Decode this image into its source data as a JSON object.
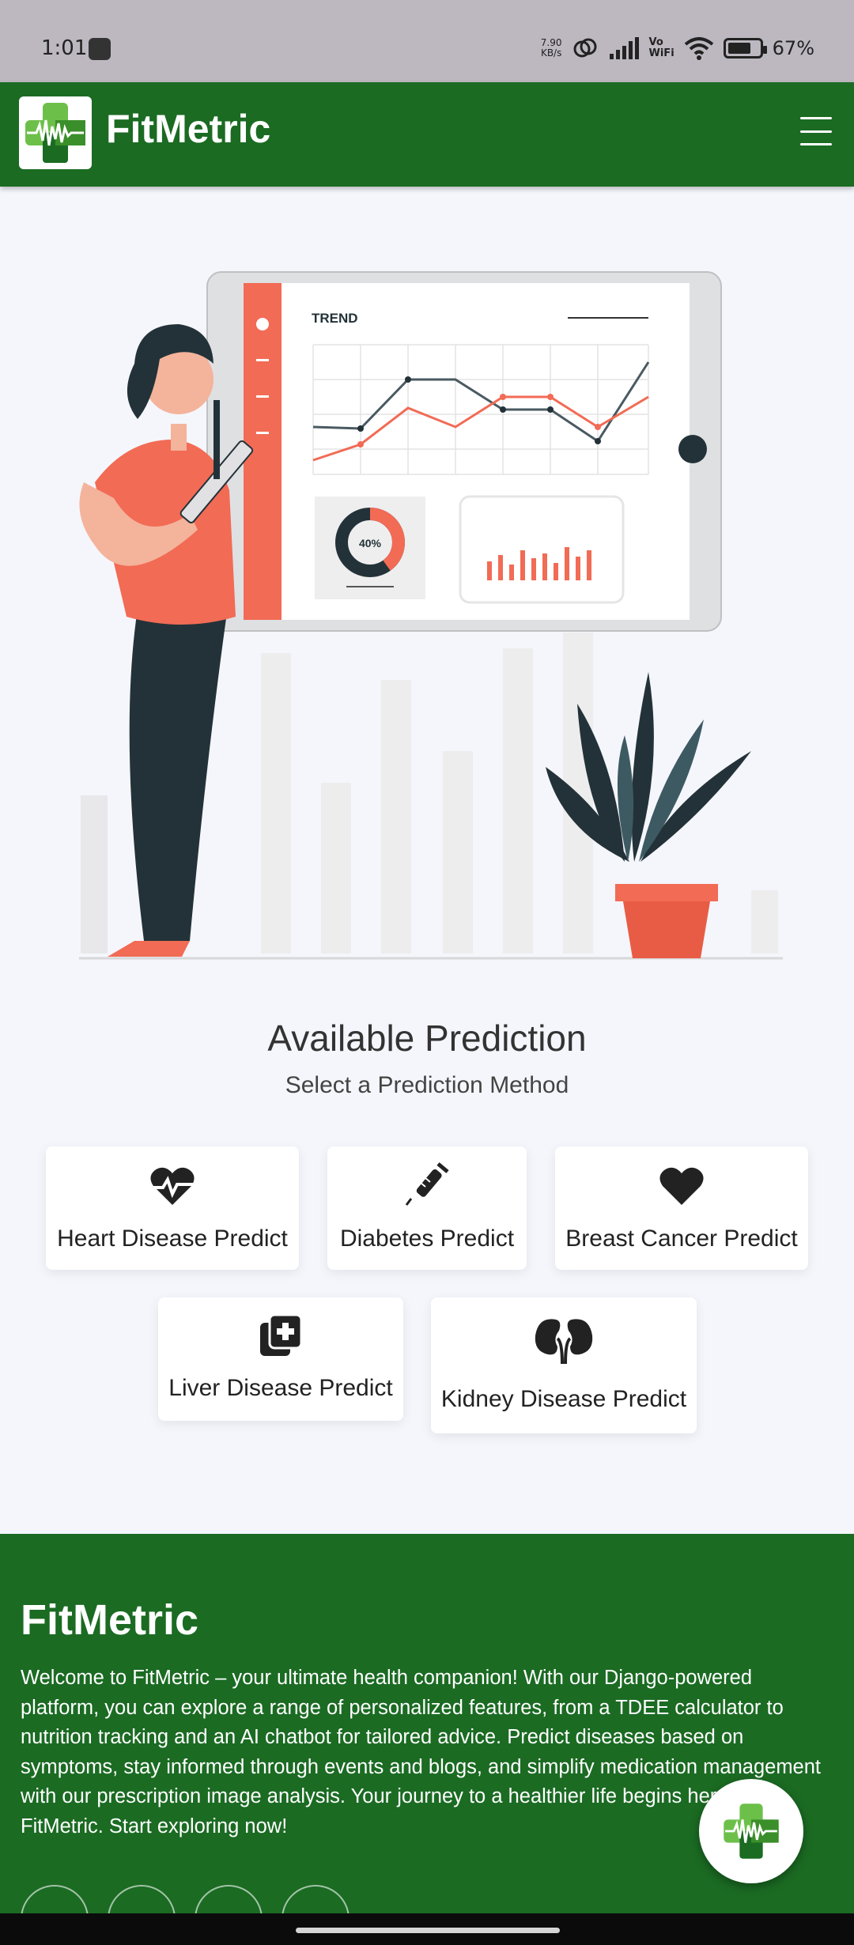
{
  "status_bar": {
    "time": "1:01",
    "speed_top": "7.90",
    "speed_unit": "KB/s",
    "vowifi_top": "Vo",
    "vowifi_bottom": "WiFi",
    "battery": "67%"
  },
  "navbar": {
    "brand": "FitMetric",
    "logo_icon": "health-cross-icon",
    "menu_icon": "hamburger-menu-icon"
  },
  "hero": {
    "dashboard_title": "TREND",
    "donut_label": "40%",
    "donut_value": 0.4
  },
  "predictions": {
    "title": "Available Prediction",
    "subtitle": "Select a Prediction Method",
    "cards": [
      {
        "label": "Heart Disease Predict",
        "icon": "heartbeat-icon"
      },
      {
        "label": "Diabetes Predict",
        "icon": "syringe-icon"
      },
      {
        "label": "Breast Cancer Predict",
        "icon": "heart-icon"
      },
      {
        "label": "Liver Disease Predict",
        "icon": "medical-notes-icon"
      },
      {
        "label": "Kidney Disease Predict",
        "icon": "kidneys-icon"
      }
    ]
  },
  "footer": {
    "brand": "FitMetric",
    "description": "Welcome to FitMetric – your ultimate health companion! With our Django-powered platform, you can explore a range of personalized features, from a TDEE calculator to nutrition tracking and an AI chatbot for tailored advice. Predict diseases based on symptoms, stay informed through events and blogs, and simplify medication management with our prescription image analysis. Your journey to a healthier life begins here at FitMetric. Start exploring now!",
    "social_icons": [
      "github-icon",
      "person-icon",
      "instagram-icon",
      "linkedin-icon"
    ]
  },
  "colors": {
    "brand_green": "#1b6b23",
    "accent_coral": "#f26b55",
    "dark_navy": "#233238"
  }
}
